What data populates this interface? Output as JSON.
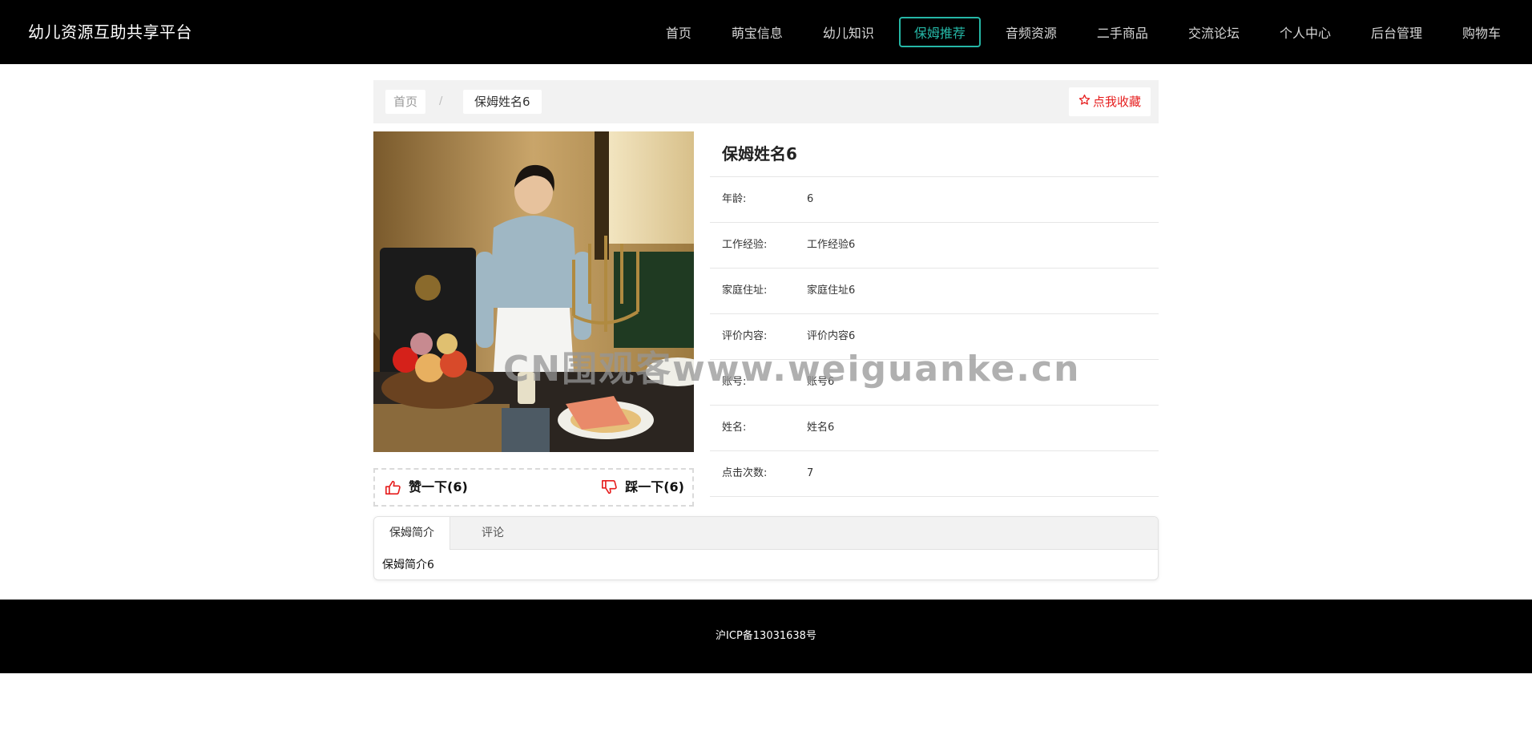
{
  "header": {
    "brand": "幼儿资源互助共享平台",
    "nav": [
      "首页",
      "萌宝信息",
      "幼儿知识",
      "保姆推荐",
      "音频资源",
      "二手商品",
      "交流论坛",
      "个人中心",
      "后台管理",
      "购物车"
    ],
    "active_nav": "保姆推荐"
  },
  "breadcrumb": {
    "home": "首页",
    "separator": "/",
    "current": "保姆姓名6"
  },
  "favorite": {
    "label": "点我收藏",
    "icon": "star-outline-icon"
  },
  "photo": {
    "alt": "nanny photo",
    "icon": "photo"
  },
  "votes": {
    "like_label": "赞一下(6)",
    "dislike_label": "踩一下(6)",
    "like_icon": "thumbs-up-icon",
    "dislike_icon": "thumbs-down-icon"
  },
  "detail": {
    "title": "保姆姓名6",
    "rows": [
      {
        "label": "年龄:",
        "value": "6"
      },
      {
        "label": "工作经验:",
        "value": "工作经验6"
      },
      {
        "label": "家庭住址:",
        "value": "家庭住址6"
      },
      {
        "label": "评价内容:",
        "value": "评价内容6"
      },
      {
        "label": "账号:",
        "value": "账号6"
      },
      {
        "label": "姓名:",
        "value": "姓名6"
      },
      {
        "label": "点击次数:",
        "value": "7"
      }
    ]
  },
  "tabs": {
    "items": [
      "保姆简介",
      "评论"
    ],
    "active": "保姆简介",
    "content": "保姆简介6"
  },
  "footer": {
    "text": "沪ICP备13031638号"
  },
  "watermark": {
    "text": "CN围观客www.weiguanke.cn"
  },
  "colors": {
    "accent": "#25b7a6",
    "favorite": "#e61e1e",
    "vote_icon": "#e61e1e"
  }
}
